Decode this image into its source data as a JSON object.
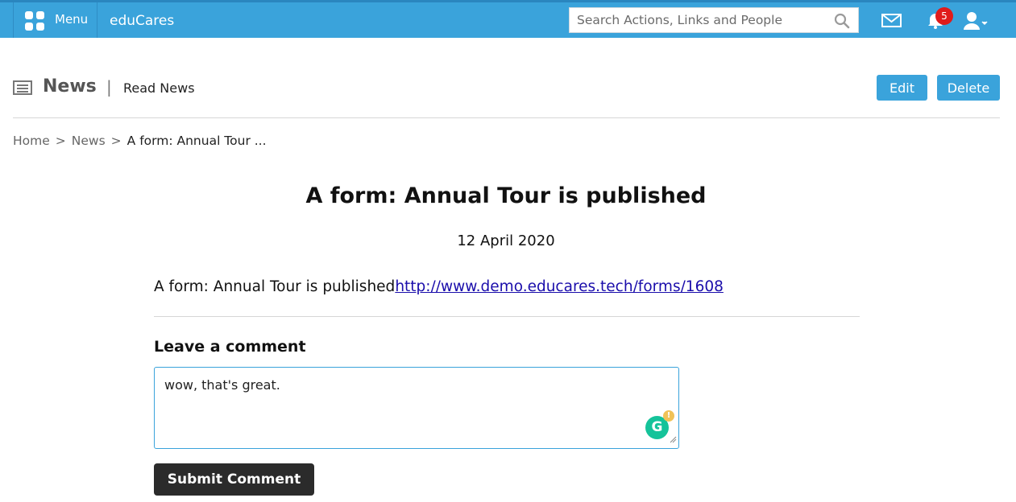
{
  "topbar": {
    "menu_label": "Menu",
    "brand": "eduCares",
    "search_placeholder": "Search Actions, Links and People",
    "notification_count": "5"
  },
  "page_header": {
    "title": "News",
    "separator": "|",
    "subtitle": "Read News",
    "edit_label": "Edit",
    "delete_label": "Delete"
  },
  "breadcrumb": {
    "items": [
      "Home",
      "News",
      "A form: Annual Tour ..."
    ],
    "separator": ">"
  },
  "article": {
    "title": "A form: Annual Tour is published",
    "date": "12 April 2020",
    "body_text": "A form: Annual Tour is published",
    "link_text": "http://www.demo.educares.tech/forms/1608"
  },
  "comment": {
    "heading": "Leave a comment",
    "value": "wow, that's great.",
    "submit_label": "Submit Comment",
    "grammarly_letter": "G",
    "grammarly_alert": "!"
  },
  "colors": {
    "accent": "#3aa3db",
    "badge": "#e01b1b",
    "submit_bg": "#2b2b2b",
    "grammarly": "#15c39a"
  },
  "icons": [
    "menu-grid-icon",
    "search-icon",
    "mail-icon",
    "bell-icon",
    "user-icon",
    "newspaper-icon",
    "grammarly-icon",
    "resize-handle-icon"
  ]
}
